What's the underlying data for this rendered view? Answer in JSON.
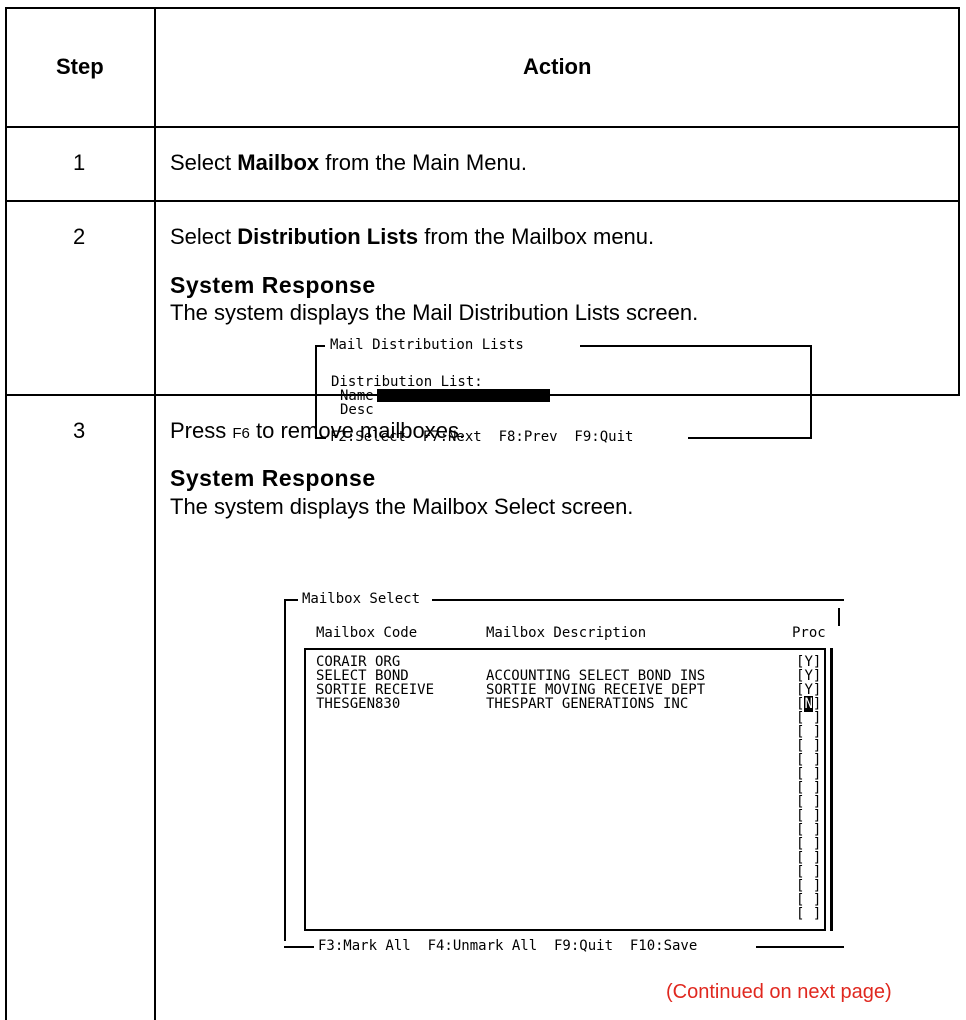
{
  "table": {
    "header": {
      "step": "Step",
      "action": "Action"
    },
    "rows": [
      {
        "step": "1",
        "pre": "Select ",
        "bold": "Mailbox",
        "post": " from the Main Menu."
      },
      {
        "step": "2",
        "pre": "Select ",
        "bold": "Distribution Lists",
        "post": " from the Mailbox menu.",
        "response_heading": "System Response",
        "response_text": "The system displays the Mail Distribution Lists screen."
      },
      {
        "step": "3",
        "pre": "Press ",
        "key": "F6",
        "post": " to remove mailboxes.",
        "response_heading": "System Response",
        "response_text": "The system displays the Mailbox Select screen."
      }
    ]
  },
  "screen1": {
    "title": "Mail Distribution Lists",
    "field_group": "Distribution List:",
    "name_label": "Name",
    "desc_label": "Desc",
    "footer": "F2:Select  F7:Next  F8:Prev  F9:Quit"
  },
  "screen2": {
    "title": "Mailbox Select",
    "col_code": "Mailbox Code",
    "col_desc": "Mailbox Description",
    "col_proc": "Proc",
    "rows": [
      {
        "code": "CORAIR ORG",
        "desc": "",
        "proc": "Y"
      },
      {
        "code": "SELECT BOND",
        "desc": "ACCOUNTING SELECT BOND INS",
        "proc": "Y"
      },
      {
        "code": "SORTIE RECEIVE",
        "desc": "SORTIE MOVING RECEIVE DEPT",
        "proc": "Y"
      },
      {
        "code": "THESGEN830",
        "desc": "THESPART GENERATIONS INC",
        "proc": "N"
      }
    ],
    "empty_slot": "[ ]",
    "footer": "F3:Mark All  F4:Unmark All  F9:Quit  F10:Save"
  },
  "continued": "(Continued on next page)"
}
